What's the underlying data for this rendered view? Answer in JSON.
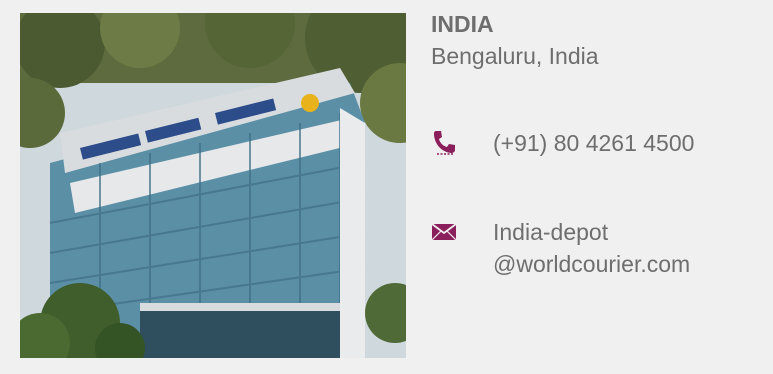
{
  "location": {
    "country": "INDIA",
    "city": "Bengaluru, India"
  },
  "contact": {
    "phone": {
      "icon": "phone-icon",
      "number": "(+91) 80 4261 4500"
    },
    "email": {
      "icon": "envelope-icon",
      "line1": "India-depot",
      "line2": "@worldcourier.com"
    }
  },
  "colors": {
    "accent": "#8a1f5c",
    "text": "#6e6e6e",
    "background": "#f0f0f0"
  }
}
